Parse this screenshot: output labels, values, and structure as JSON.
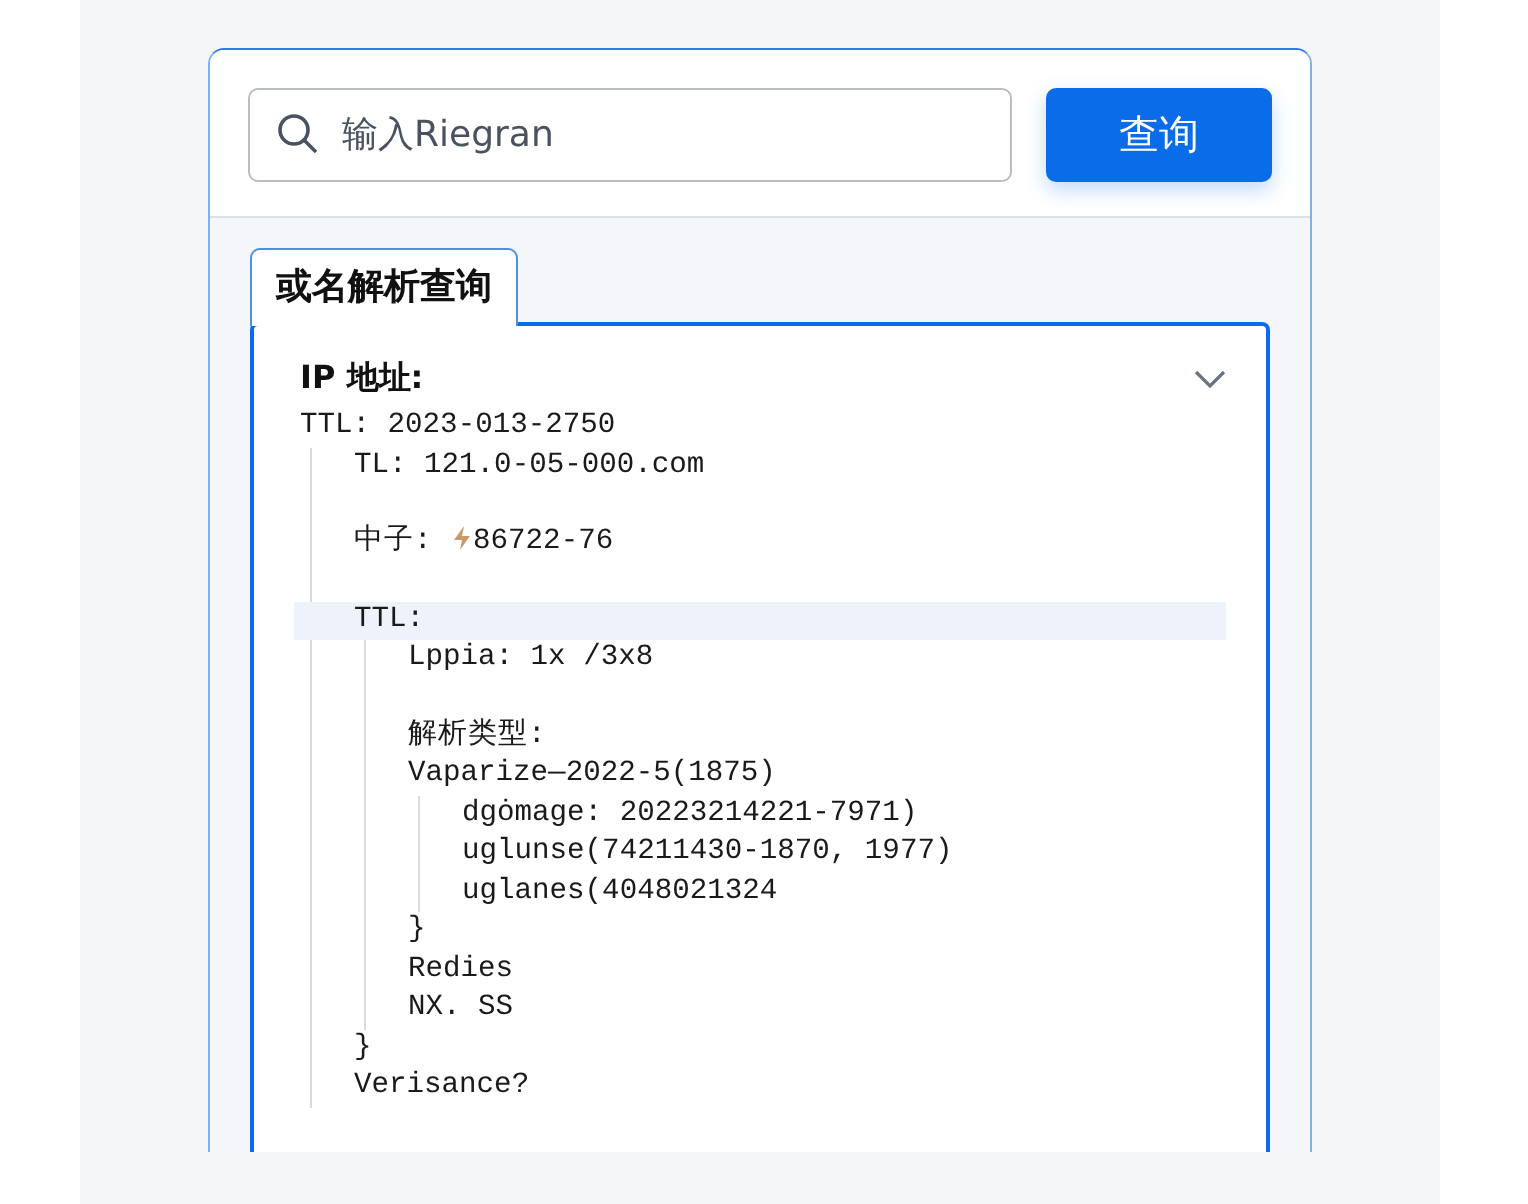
{
  "search": {
    "placeholder": "输入Riegran",
    "button": "查询"
  },
  "tab": {
    "label": "或名解析查询",
    "selected": true
  },
  "panel": {
    "title": "IP 地址:",
    "expanded": true,
    "tree": [
      {
        "text": "TTL: 2023-013-2750",
        "selected": false,
        "children": [
          {
            "text": "TL: 121.0-05-000.com",
            "selected": false
          },
          {
            "text": "中子:",
            "kind": "icon-value",
            "value": "86722-76",
            "gap_before": true,
            "selected": false
          },
          {
            "text": "TTL:",
            "gap_before": true,
            "selected": true,
            "children": [
              {
                "text": "Lppia: 1x /3x8",
                "selected": false
              },
              {
                "text": "解析类型:",
                "gap_before": true,
                "selected": false
              },
              {
                "text": "Vaparize—2022-5(1875)",
                "selected": false,
                "children": [
                  {
                    "text": "dgȯmage: 20223214221-7971)",
                    "selected": false
                  },
                  {
                    "text": "uglunse(74211430-1870, 1977)",
                    "selected": false
                  },
                  {
                    "text": "uglanes(4048021324",
                    "selected": false
                  }
                ]
              },
              {
                "text": "}",
                "selected": false
              },
              {
                "text": "Redies",
                "selected": false
              },
              {
                "text": "NX. SS",
                "selected": false
              }
            ]
          },
          {
            "text": "}",
            "selected": false
          },
          {
            "text": "Verisance?",
            "selected": false
          }
        ]
      }
    ]
  }
}
